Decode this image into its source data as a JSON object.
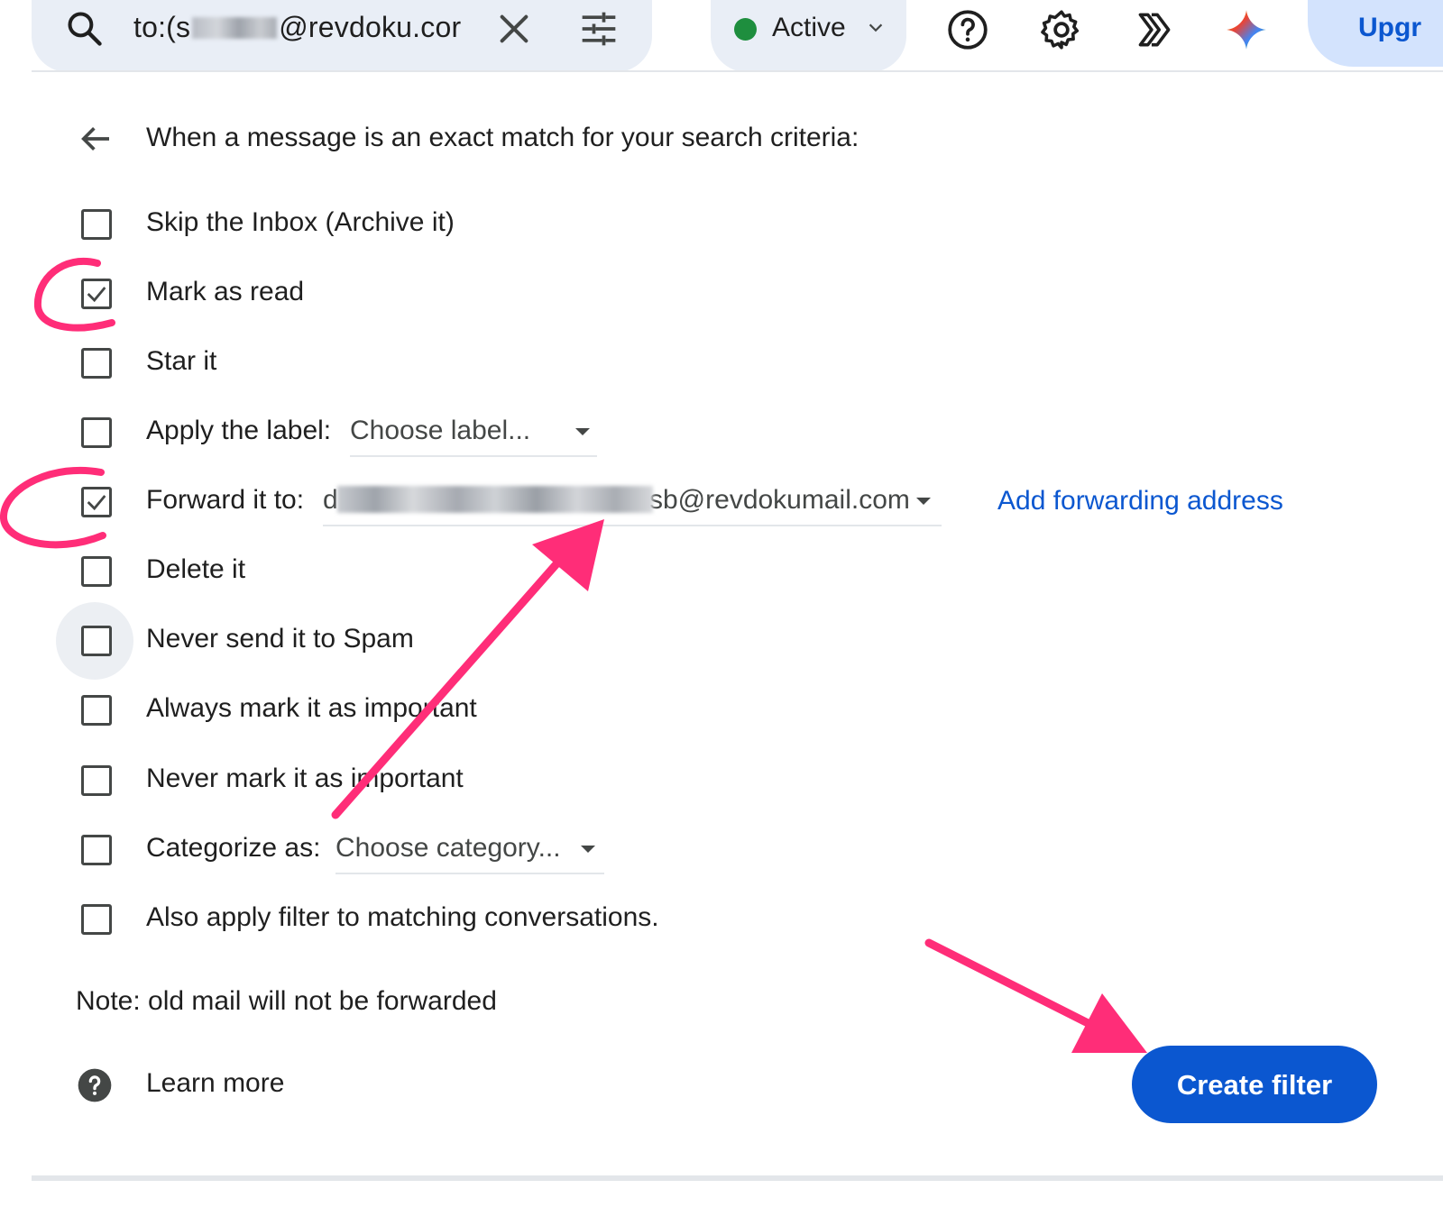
{
  "search": {
    "query_prefix": "to:(s",
    "query_suffix": "@revdoku.cor"
  },
  "status": {
    "label": "Active",
    "color": "#1e8e3e"
  },
  "topbar_icons": [
    "help-circle-icon",
    "gear-icon",
    "chevrons-right-icon",
    "gemini-sparkle-icon"
  ],
  "upgrade": {
    "label": "Upgr"
  },
  "filter": {
    "heading": "When a message is an exact match for your search criteria:",
    "options": [
      {
        "label": "Skip the Inbox (Archive it)",
        "checked": false
      },
      {
        "label": "Mark as read",
        "checked": true
      },
      {
        "label": "Star it",
        "checked": false
      },
      {
        "label": "Apply the label:",
        "checked": false,
        "select_value": "Choose label..."
      },
      {
        "label": "Forward it to:",
        "checked": true,
        "select_prefix": "d",
        "select_value": "sb@revdokumail.com"
      },
      {
        "label": "Delete it",
        "checked": false
      },
      {
        "label": "Never send it to Spam",
        "checked": false
      },
      {
        "label": "Always mark it as important",
        "checked": false
      },
      {
        "label": "Never mark it as important",
        "checked": false
      },
      {
        "label": "Categorize as:",
        "checked": false,
        "select_value": "Choose category..."
      },
      {
        "label": "Also apply filter to matching conversations.",
        "checked": false
      }
    ],
    "add_forwarding_link": "Add forwarding address",
    "note": "Note: old mail will not be forwarded",
    "learn_more": "Learn more",
    "create_button": "Create filter"
  },
  "colors": {
    "accent": "#0b57d0",
    "annotation": "#ff2d78",
    "search_bg": "#e9eef6"
  }
}
